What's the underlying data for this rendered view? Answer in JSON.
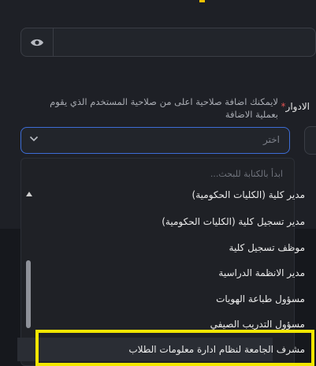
{
  "form": {
    "roles_label": "الادوار",
    "roles_required_mark": "*",
    "roles_hint": "لايمكنك اضافة صلاحية اعلى من صلاحية المستخدم الذي يقوم بعملية الاضافة",
    "select_placeholder": "اختر"
  },
  "dropdown": {
    "search_hint": "ابدأ بالكتابة للبحث...",
    "options": [
      "مدير كلية (الكليات الحكومية)",
      "مدير تسجيل كلية (الكليات الحكومية)",
      "موظف تسجيل كلية",
      "مدير الانظمة الدراسية",
      "مسؤول طباعة الهويات",
      "مسؤول التدريب الصيفي",
      "مشرف الجامعة لنظام ادارة معلومات الطلاب"
    ],
    "highlighted_index": 6
  },
  "icons": {
    "eye": "eye-icon",
    "chevron": "chevron-down-icon",
    "scroll_up": "scroll-up-arrow-icon"
  },
  "colors": {
    "focus_border": "#3d6dd6",
    "highlight_annotation": "#f2e600",
    "required": "#e05252"
  }
}
